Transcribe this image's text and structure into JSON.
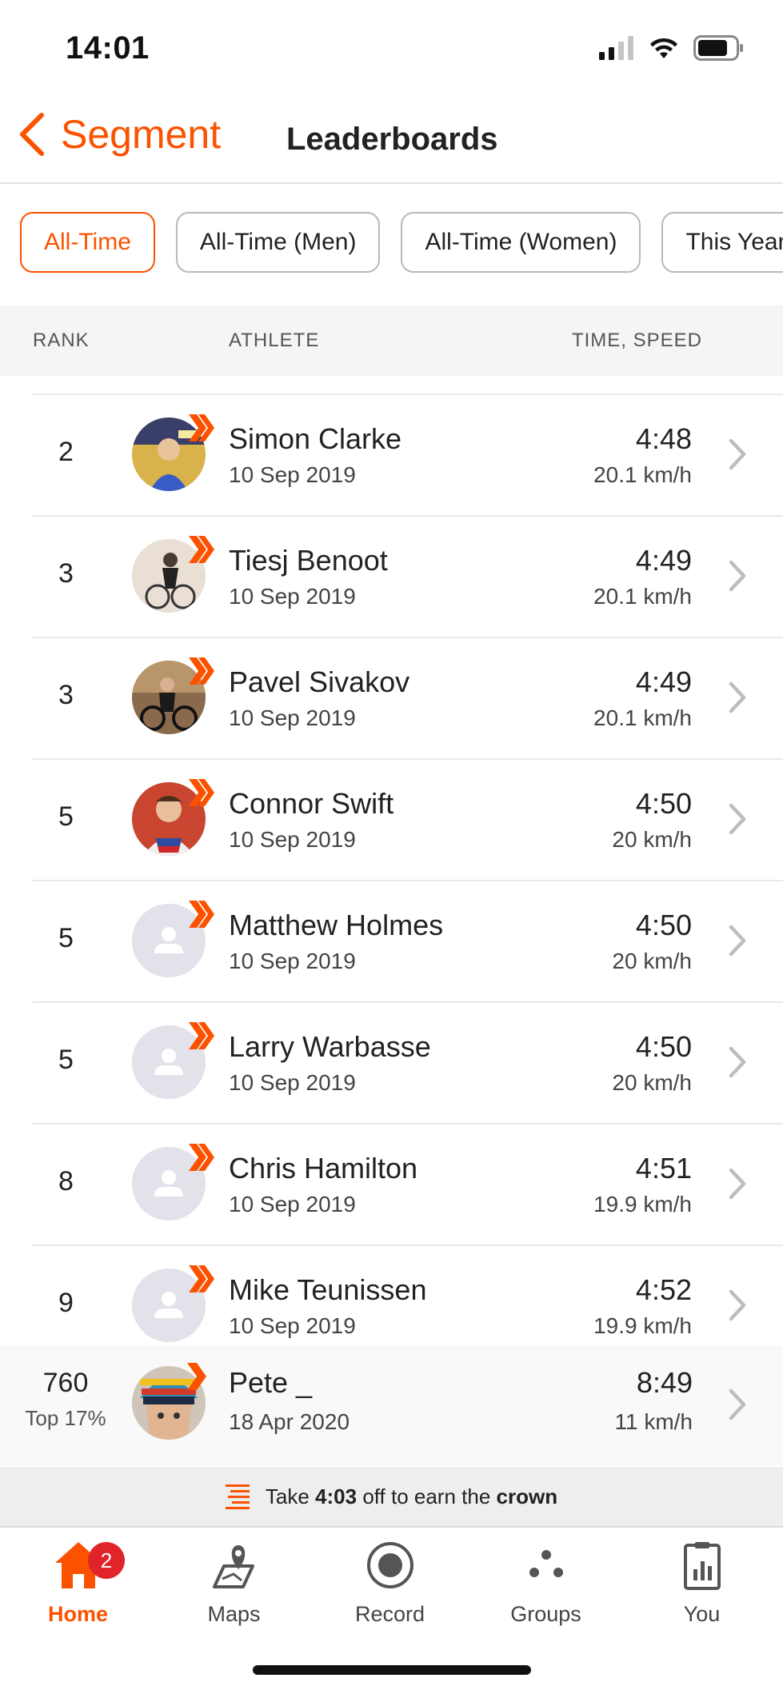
{
  "status_bar": {
    "time": "14:01"
  },
  "nav": {
    "back_label": "Segment",
    "title": "Leaderboards"
  },
  "filters": [
    "All-Time",
    "All-Time (Men)",
    "All-Time (Women)",
    "This Year"
  ],
  "columns": {
    "rank": "RANK",
    "athlete": "ATHLETE",
    "time_speed": "TIME, SPEED"
  },
  "rows": [
    {
      "rank": "2",
      "name": "Simon Clarke",
      "date": "10 Sep 2019",
      "time": "4:48",
      "speed": "20.1 km/h",
      "avatar": "photo"
    },
    {
      "rank": "3",
      "name": "Tiesj Benoot",
      "date": "10 Sep 2019",
      "time": "4:49",
      "speed": "20.1 km/h",
      "avatar": "photo"
    },
    {
      "rank": "3",
      "name": "Pavel Sivakov",
      "date": "10 Sep 2019",
      "time": "4:49",
      "speed": "20.1 km/h",
      "avatar": "photo"
    },
    {
      "rank": "5",
      "name": "Connor Swift",
      "date": "10 Sep 2019",
      "time": "4:50",
      "speed": "20 km/h",
      "avatar": "photo"
    },
    {
      "rank": "5",
      "name": "Matthew Holmes",
      "date": "10 Sep 2019",
      "time": "4:50",
      "speed": "20 km/h",
      "avatar": "placeholder"
    },
    {
      "rank": "5",
      "name": "Larry Warbasse",
      "date": "10 Sep 2019",
      "time": "4:50",
      "speed": "20 km/h",
      "avatar": "placeholder"
    },
    {
      "rank": "8",
      "name": "Chris Hamilton",
      "date": "10 Sep 2019",
      "time": "4:51",
      "speed": "19.9 km/h",
      "avatar": "placeholder"
    },
    {
      "rank": "9",
      "name": "Mike Teunissen",
      "date": "10 Sep 2019",
      "time": "4:52",
      "speed": "19.9 km/h",
      "avatar": "placeholder"
    }
  ],
  "my_entry": {
    "rank": "760",
    "percentile": "Top 17%",
    "name": "Pete _",
    "date": "18 Apr 2020",
    "time": "8:49",
    "speed": "11 km/h"
  },
  "banner": {
    "prefix": "Take ",
    "time": "4:03",
    "middle": " off to earn the ",
    "crown": "crown"
  },
  "tabs": [
    {
      "label": "Home",
      "icon": "home-icon",
      "active": true,
      "badge": "2"
    },
    {
      "label": "Maps",
      "icon": "map-pin-icon"
    },
    {
      "label": "Record",
      "icon": "record-icon"
    },
    {
      "label": "Groups",
      "icon": "groups-icon"
    },
    {
      "label": "You",
      "icon": "clipboard-chart-icon"
    }
  ],
  "colors": {
    "accent": "#fc5200",
    "badge": "#e0242a",
    "chevron": "#bdbdbd"
  }
}
